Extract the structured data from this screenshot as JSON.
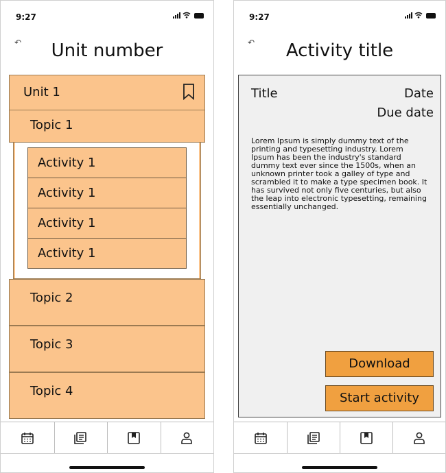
{
  "status_bar": {
    "time": "9:27"
  },
  "left_screen": {
    "title": "Unit number",
    "unit": {
      "label": "Unit 1"
    },
    "topics": [
      {
        "label": "Topic 1"
      },
      {
        "label": "Topic 2"
      },
      {
        "label": "Topic 3"
      },
      {
        "label": "Topic 4"
      }
    ],
    "activities": [
      {
        "label": "Activity 1"
      },
      {
        "label": "Activity 1"
      },
      {
        "label": "Activity 1"
      },
      {
        "label": "Activity 1"
      }
    ]
  },
  "right_screen": {
    "title": "Activity title",
    "item_title": "Title",
    "date": "Date",
    "due_date": "Due date",
    "body": "Lorem Ipsum is simply dummy text of the printing and typesetting industry. Lorem Ipsum has been the industry's standard dummy text ever since the 1500s, when an unknown printer took a galley of type and scrambled it to make a type specimen book. It has survived not only five centuries, but also the leap into electronic typesetting, remaining essentially unchanged.",
    "download_label": "Download",
    "start_label": "Start activity"
  },
  "tabbar": {
    "icons": [
      "calendar-icon",
      "library-icon",
      "bookmark-icon",
      "profile-icon"
    ]
  },
  "colors": {
    "row_fill": "#fbc48c",
    "button_fill": "#f0a040",
    "card_fill": "#f0f0f0"
  }
}
